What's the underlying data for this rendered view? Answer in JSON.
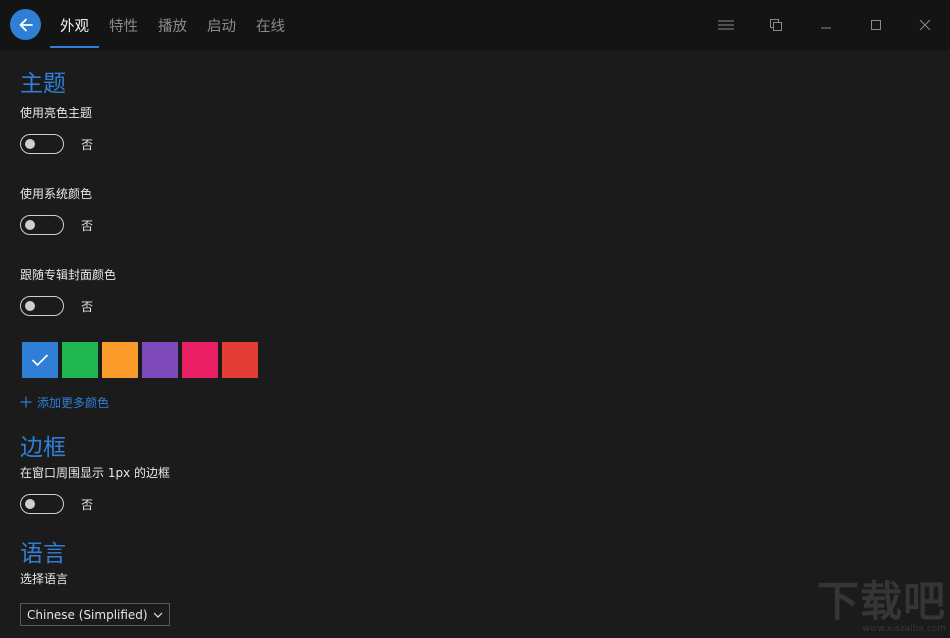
{
  "header": {
    "tabs": [
      {
        "label": "外观",
        "active": true
      },
      {
        "label": "特性",
        "active": false
      },
      {
        "label": "播放",
        "active": false
      },
      {
        "label": "启动",
        "active": false
      },
      {
        "label": "在线",
        "active": false
      }
    ],
    "back_icon": "arrow-left-icon",
    "accent_color": "#2f7fd6"
  },
  "window_controls": [
    "menu-icon",
    "restore-icon",
    "minimize-icon",
    "maximize-icon",
    "close-icon"
  ],
  "theme": {
    "title": "主题",
    "light_theme": {
      "label": "使用亮色主题",
      "state": "否",
      "on": false
    },
    "system_color": {
      "label": "使用系统颜色",
      "state": "否",
      "on": false
    },
    "album_color": {
      "label": "跟随专辑封面颜色",
      "state": "否",
      "on": false
    },
    "swatches": [
      {
        "color": "#2f7fd6",
        "selected": true
      },
      {
        "color": "#1fb752",
        "selected": false
      },
      {
        "color": "#fb9b29",
        "selected": false
      },
      {
        "color": "#7d48ba",
        "selected": false
      },
      {
        "color": "#ea1f63",
        "selected": false
      },
      {
        "color": "#e33c35",
        "selected": false
      }
    ],
    "add_color": "添加更多颜色"
  },
  "border": {
    "title": "边框",
    "show_border": {
      "label": "在窗口周围显示 1px 的边框",
      "state": "否",
      "on": false
    }
  },
  "language": {
    "title": "语言",
    "label": "选择语言",
    "selected": "Chinese (Simplified)"
  },
  "watermark": {
    "text": "下载吧",
    "url": "www.xiazaiba.com"
  }
}
